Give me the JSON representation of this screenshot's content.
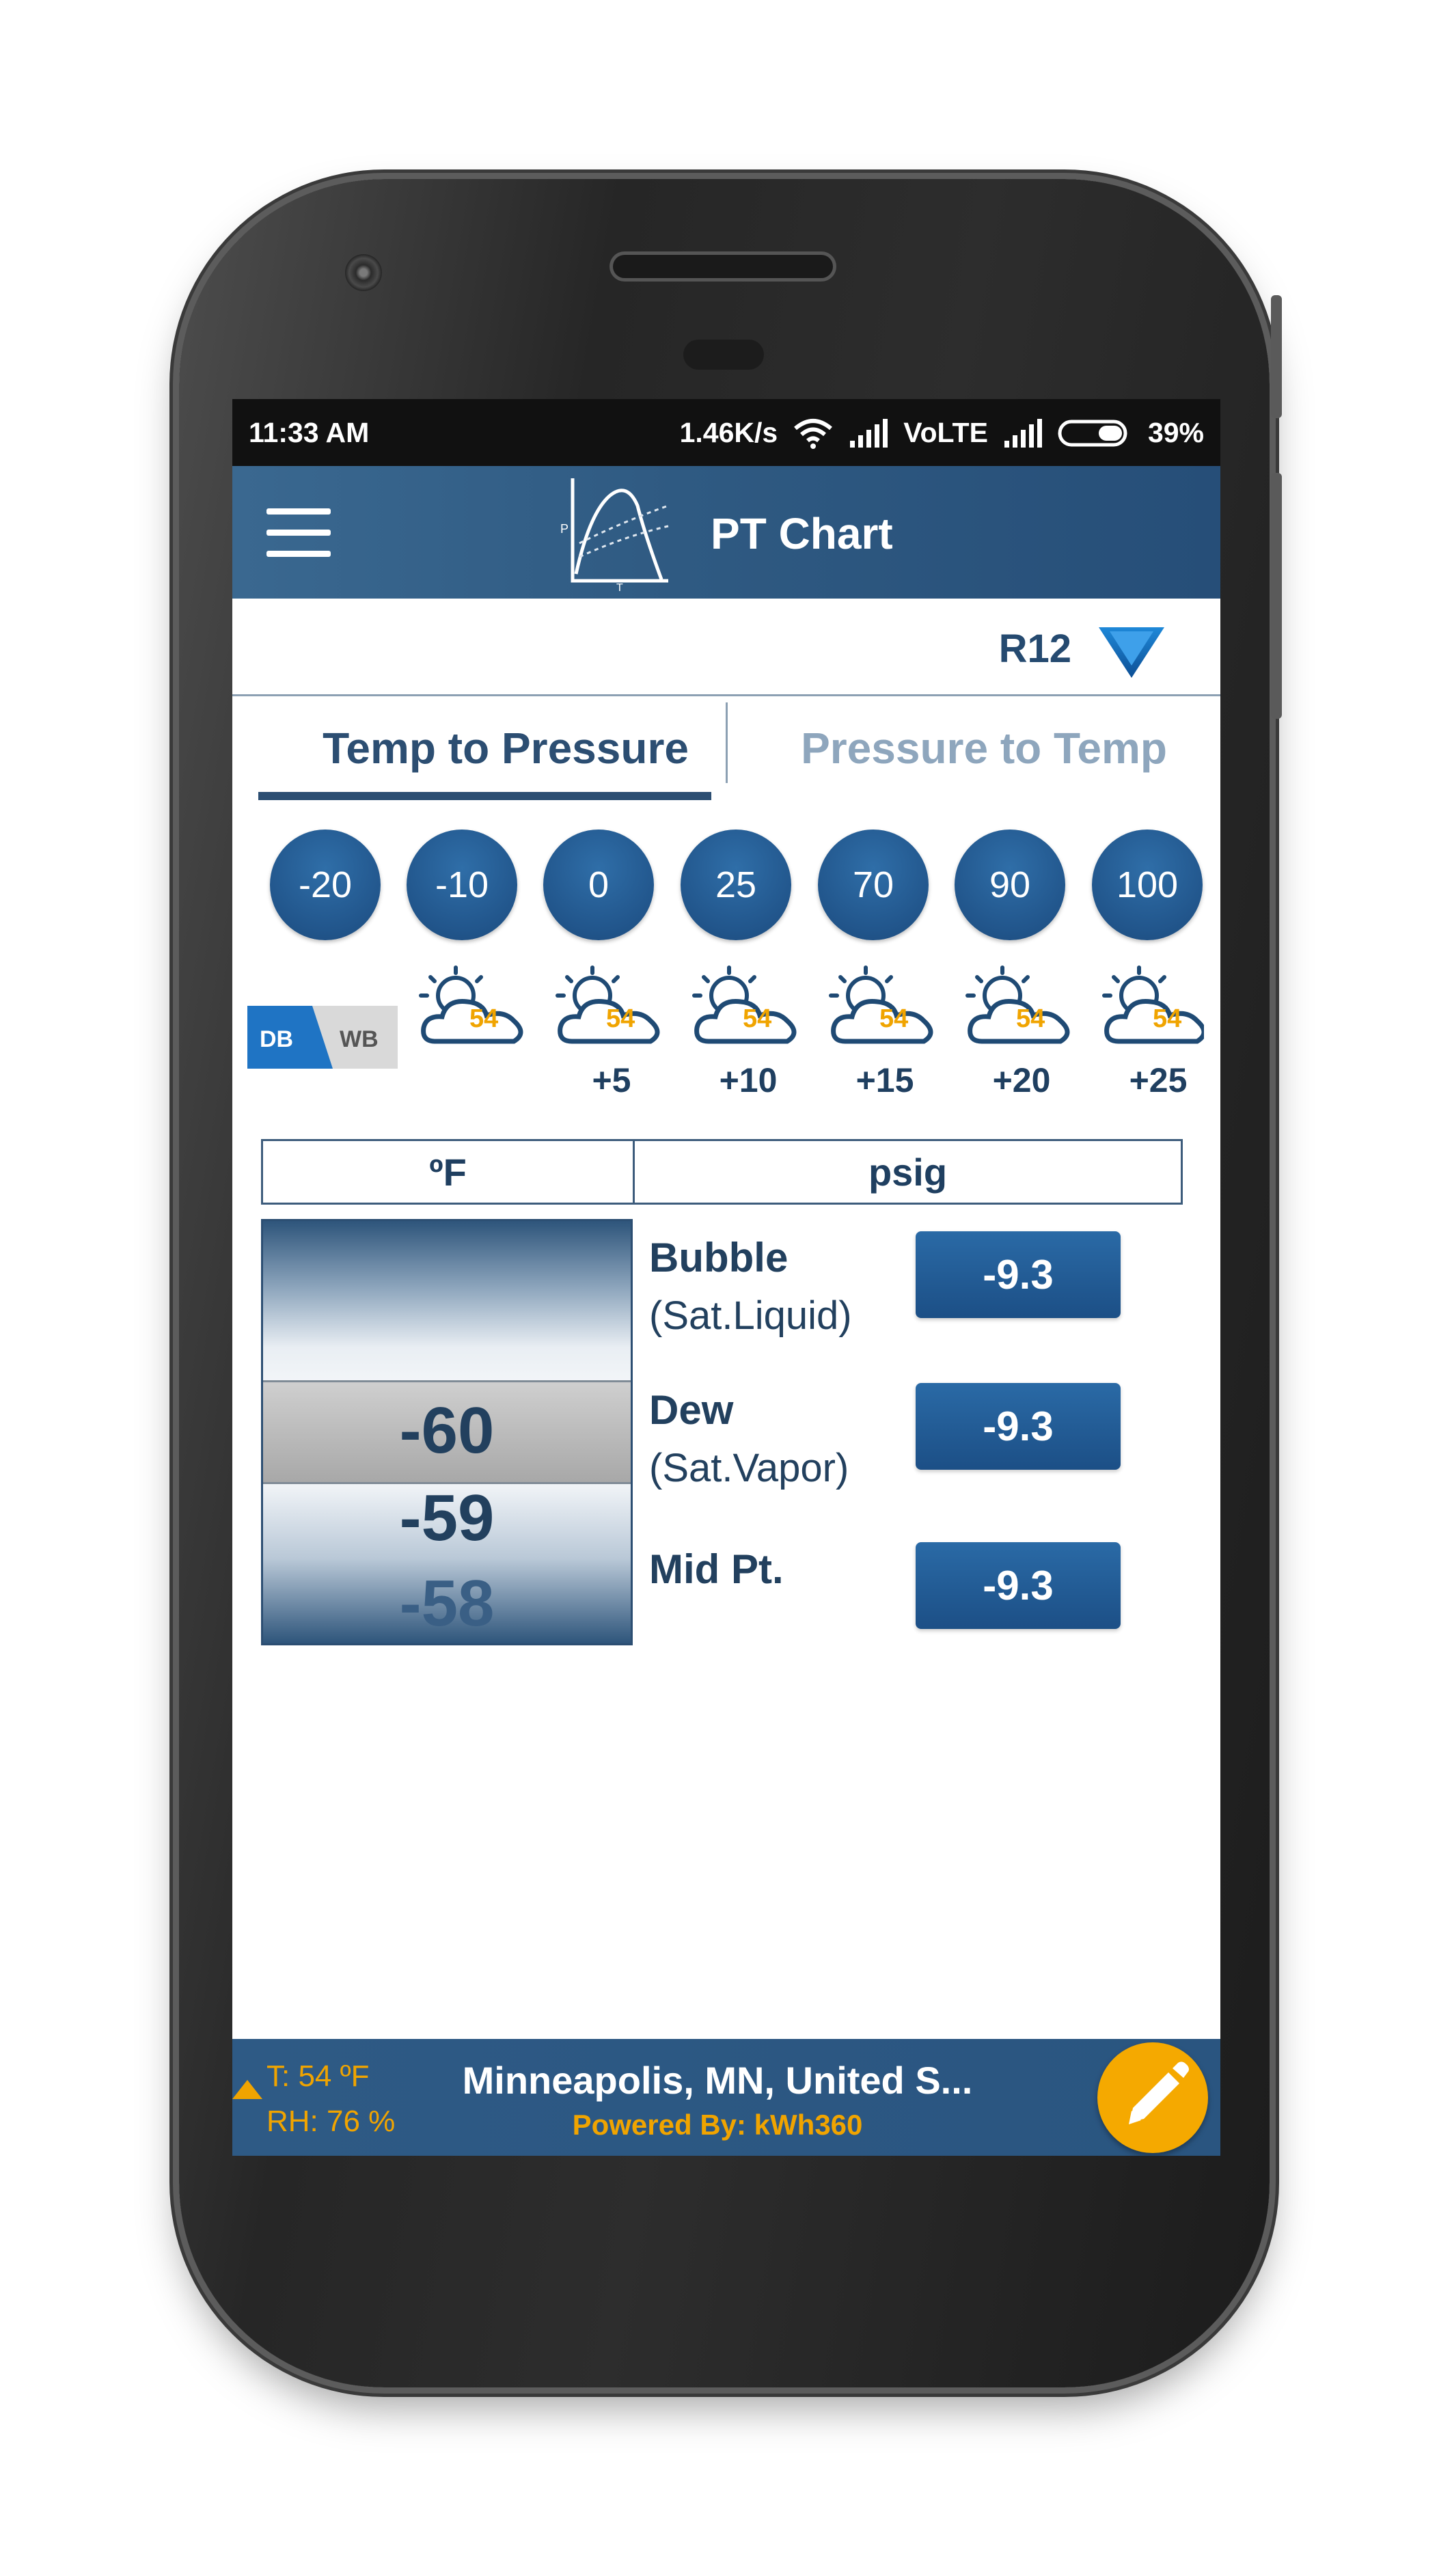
{
  "status_bar": {
    "time": "11:33 AM",
    "network_speed": "1.46K/s",
    "carrier": "VoLTE",
    "battery": "39%"
  },
  "app_bar": {
    "title": "PT Chart",
    "logo_axis_p": "P",
    "logo_axis_t": "T"
  },
  "refrigerant": {
    "selected": "R12"
  },
  "tabs": [
    {
      "label": "Temp to Pressure",
      "active": true
    },
    {
      "label": "Pressure to Temp",
      "active": false
    }
  ],
  "quick_temps": [
    "-20",
    "-10",
    "0",
    "25",
    "70",
    "90",
    "100"
  ],
  "bulb_toggle": {
    "db": "DB",
    "wb": "WB"
  },
  "weather_offsets": [
    {
      "temp": "54",
      "offset": ""
    },
    {
      "temp": "54",
      "offset": "+5"
    },
    {
      "temp": "54",
      "offset": "+10"
    },
    {
      "temp": "54",
      "offset": "+15"
    },
    {
      "temp": "54",
      "offset": "+20"
    },
    {
      "temp": "54",
      "offset": "+25"
    }
  ],
  "table": {
    "temp_unit": "ºF",
    "pressure_unit": "psig"
  },
  "picker": {
    "selected": "-60",
    "next": "-59",
    "after": "-58"
  },
  "results": [
    {
      "label": "Bubble",
      "sub": "(Sat.Liquid)",
      "value": "-9.3"
    },
    {
      "label": "Dew",
      "sub": "(Sat.Vapor)",
      "value": "-9.3"
    },
    {
      "label": "Mid Pt.",
      "sub": "",
      "value": "-9.3"
    }
  ],
  "footer": {
    "temperature": "T: 54 ºF",
    "humidity": "RH: 76 %",
    "location": "Minneapolis, MN, United S...",
    "powered_by": "Powered By: kWh360"
  },
  "colors": {
    "primary": "#2c4e72",
    "accent": "#f5a900",
    "button_blue": "#21558b"
  }
}
